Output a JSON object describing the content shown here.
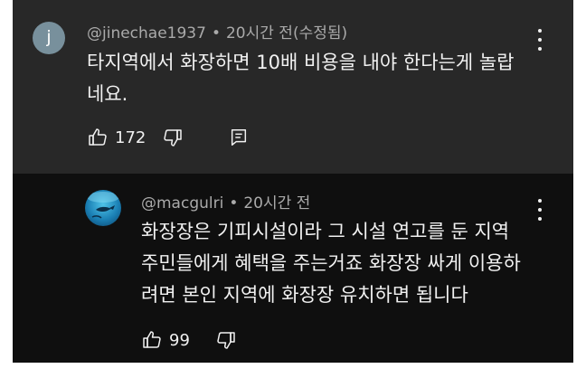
{
  "comments": [
    {
      "avatar_letter": "j",
      "author": "@jinechae1937",
      "separator": "•",
      "time": "20시간 전(수정됨)",
      "lines": [
        "타지역에서 화장하면 10배 비용을 내야 한다는게 놀랍",
        "네요."
      ],
      "likes": "172",
      "icons": [
        "thumb-up-icon",
        "thumb-down-icon",
        "reply-icon",
        "more-vert-icon"
      ]
    },
    {
      "author": "@macgulri",
      "separator": "•",
      "time": "20시간 전",
      "lines": [
        "화장장은 기피시설이라 그 시설 연고를 둔 지역",
        "주민들에게 혜택을 주는거죠 화장장 싸게 이용하",
        "려면 본인 지역에 화장장 유치하면 됩니다"
      ],
      "likes": "99",
      "icons": [
        "thumb-up-icon",
        "thumb-down-icon",
        "more-vert-icon"
      ]
    }
  ],
  "colors": {
    "top_bg": "#282828",
    "reply_bg": "#0f0f0f",
    "text": "#f1f1f1",
    "meta": "#aaaaaa",
    "avatar_j": "#78909c"
  }
}
